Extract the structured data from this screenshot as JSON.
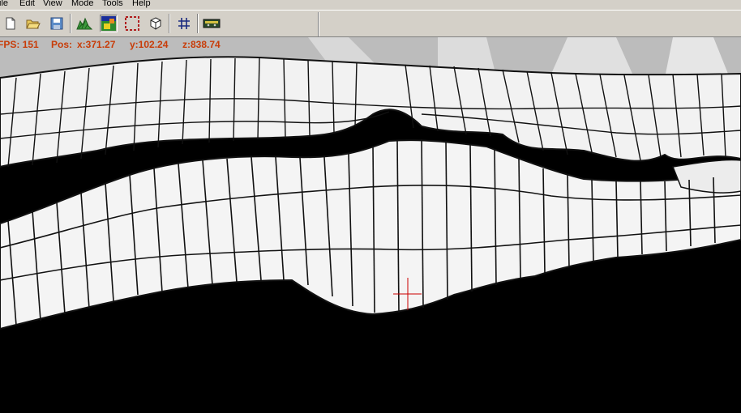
{
  "menu": {
    "file": "ile",
    "edit": "Edit",
    "view": "View",
    "mode": "Mode",
    "tools": "Tools",
    "help": "Help"
  },
  "toolbar": {
    "buttons": [
      "new-file",
      "open-folder",
      "save-disk",
      "terrain",
      "color-map",
      "selection",
      "cube",
      "grid",
      "cassette"
    ]
  },
  "status": {
    "fps": "FPS: 151",
    "pos_label": "Pos:",
    "x": "x:371.27",
    "y": "y:102.24",
    "z": "z:838.74"
  },
  "colors": {
    "chrome": "#d4d0c8",
    "status_text": "#c83c08",
    "crosshair": "#cc0000",
    "mesh": "#f4f4f4"
  }
}
